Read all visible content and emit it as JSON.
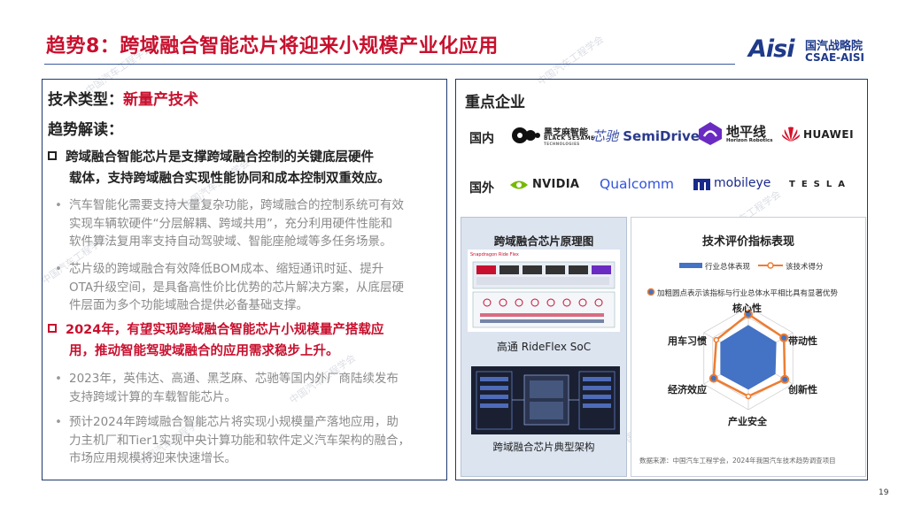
{
  "title": "趋势8：跨域融合智能芯片将迎来小规模产业化应用",
  "logo": {
    "mark": "Aisi",
    "cn": "国汽战略院",
    "en": "CSAE-AISI"
  },
  "left": {
    "tech_type_label": "技术类型：",
    "tech_type_value": "新量产技术",
    "interp_label": "趋势解读：",
    "point1": {
      "line1": "跨域融合智能芯片是支撑跨域融合控制的关键底层硬件",
      "line2": "载体，支持跨域融合实现性能协同和成本控制双重效应。"
    },
    "sub1": [
      "汽车智能化需要支持大量复杂功能，跨域融合的控制系统可有效",
      "实现车辆软硬件“分层解耦、跨域共用”，充分利用硬件性能和",
      "软件算法复用率支持自动驾驶域、智能座舱域等多任务场景。"
    ],
    "sub2": [
      "芯片级的跨域融合有效降低BOM成本、缩短通讯时延、提升",
      "OTA升级空间，是具备高性价比优势的芯片解决方案，从底层硬",
      "件层面为多个功能域融合提供必备基础支撑。"
    ],
    "point2": {
      "line1": "2024年，有望实现跨域融合智能芯片小规模量产搭载应",
      "line2": "用，推动智能驾驶域融合的应用需求稳步上升。"
    },
    "sub3": [
      "2023年，英伟达、高通、黑芝麻、芯驰等国内外厂商陆续发布",
      "支持跨域计算的车载智能芯片。"
    ],
    "sub4": [
      "预计2024年跨域融合智能芯片将实现小规模量产落地应用，助",
      "力主机厂和Tier1实现中央计算功能和软件定义汽车架构的融合，",
      "市场应用规模将迎来快速增长。"
    ]
  },
  "right": {
    "key_enterprises": "重点企业",
    "domestic_label": "国内",
    "foreign_label": "国外",
    "domestic_brands": {
      "black_sesame_cn": "黑芝麻智能",
      "black_sesame_en": "BLACK SESAME",
      "black_sesame_sub": "TECHNOLOGIES",
      "semidrive_cn": "芯驰",
      "semidrive_en": "SemiDrive",
      "horizon_cn": "地平线",
      "horizon_en": "Horizon Robotics",
      "huawei": "HUAWEI"
    },
    "foreign_brands": {
      "nvidia": "NVIDIA",
      "qualcomm": "Qualcomm",
      "mobileye": "mobileye",
      "tesla": "TESLA"
    },
    "principle": {
      "title": "跨域融合芯片原理图",
      "diagram1_header": "Snapdragon Ride Flex",
      "caption1": "高通 RideFlex SoC",
      "caption2": "跨域融合芯片典型架构"
    },
    "evaluation": {
      "title": "技术评价指标表现",
      "legend_industry": "行业总体表现",
      "legend_tech": "该技术得分",
      "note": "加粗圆点表示该指标与行业总体水平相比具有显著优势",
      "source": "数据来源：中国汽车工程学会，2024年我国汽车技术趋势调查项目"
    },
    "chart_data": {
      "type": "radar",
      "axes": [
        "核心性",
        "带动性",
        "创新性",
        "产业安全",
        "经济效应",
        "用车习惯"
      ],
      "range": [
        0,
        5
      ],
      "series": [
        {
          "name": "行业总体表现",
          "values": [
            3.2,
            3.1,
            3.0,
            3.0,
            3.1,
            3.1
          ],
          "color": "#4472c4"
        },
        {
          "name": "该技术得分",
          "values": [
            4.3,
            4.0,
            4.1,
            3.7,
            3.9,
            3.6
          ],
          "color": "#ed7d31",
          "highlight": [
            true,
            true,
            true,
            false,
            true,
            false
          ]
        }
      ]
    }
  },
  "page_number": "19",
  "watermark": "中国汽车工程学会",
  "colors": {
    "accent_red": "#c8102e",
    "navy": "#1f3a6e",
    "industry": "#4472c4",
    "tech": "#ed7d31"
  }
}
